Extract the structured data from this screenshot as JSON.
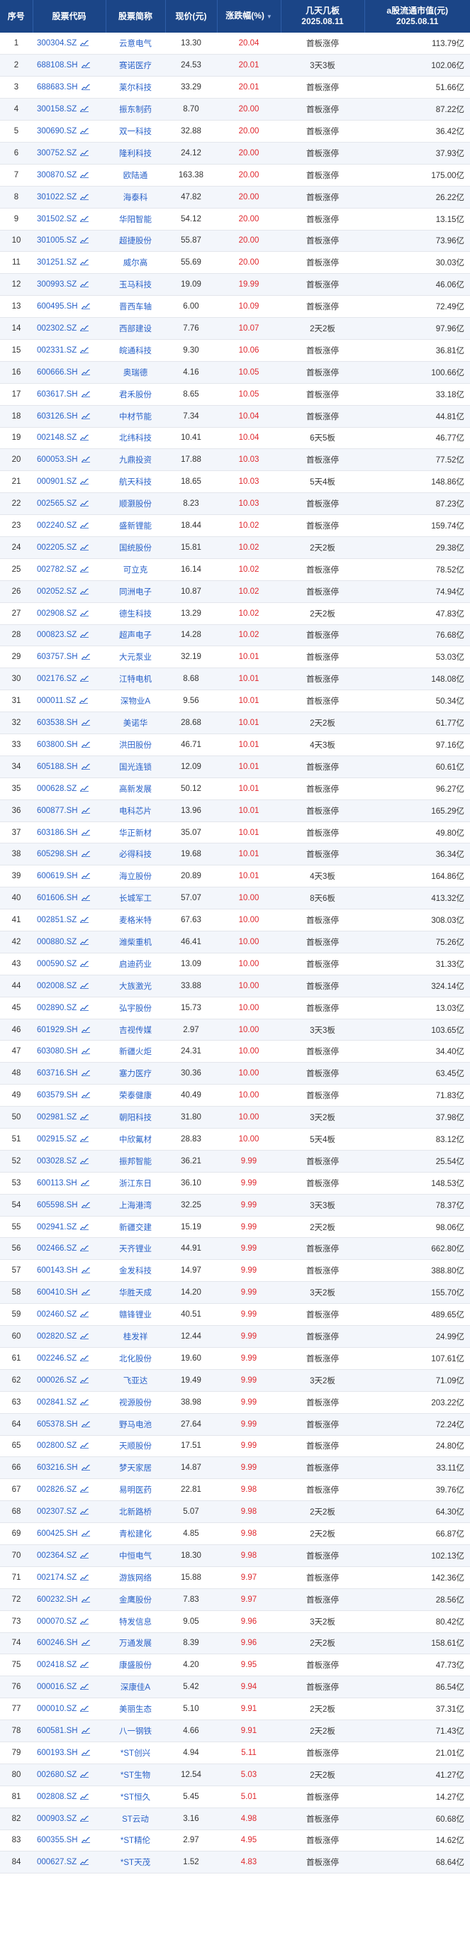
{
  "headers": {
    "index": "序号",
    "code": "股票代码",
    "name": "股票简称",
    "price": "现价(元)",
    "change": "涨跌幅(%)",
    "board_line1": "几天几板",
    "board_line2": "2025.08.11",
    "cap_line1": "a股流通市值(元)",
    "cap_line2": "2025.08.11"
  },
  "icons": {
    "sort": "sort-desc-icon",
    "chart": "trend-chart-icon"
  },
  "colors": {
    "header_bg": "#1b4587",
    "link": "#2a62c9",
    "up": "#e0282e"
  },
  "rows": [
    {
      "idx": "1",
      "code": "300304.SZ",
      "name": "云意电气",
      "price": "13.30",
      "change": "20.04",
      "board": "首板涨停",
      "cap": "113.79亿"
    },
    {
      "idx": "2",
      "code": "688108.SH",
      "name": "赛诺医疗",
      "price": "24.53",
      "change": "20.01",
      "board": "3天3板",
      "cap": "102.06亿"
    },
    {
      "idx": "3",
      "code": "688683.SH",
      "name": "莱尔科技",
      "price": "33.29",
      "change": "20.01",
      "board": "首板涨停",
      "cap": "51.66亿"
    },
    {
      "idx": "4",
      "code": "300158.SZ",
      "name": "振东制药",
      "price": "8.70",
      "change": "20.00",
      "board": "首板涨停",
      "cap": "87.22亿"
    },
    {
      "idx": "5",
      "code": "300690.SZ",
      "name": "双一科技",
      "price": "32.88",
      "change": "20.00",
      "board": "首板涨停",
      "cap": "36.42亿"
    },
    {
      "idx": "6",
      "code": "300752.SZ",
      "name": "隆利科技",
      "price": "24.12",
      "change": "20.00",
      "board": "首板涨停",
      "cap": "37.93亿"
    },
    {
      "idx": "7",
      "code": "300870.SZ",
      "name": "欧陆通",
      "price": "163.38",
      "change": "20.00",
      "board": "首板涨停",
      "cap": "175.00亿"
    },
    {
      "idx": "8",
      "code": "301022.SZ",
      "name": "海泰科",
      "price": "47.82",
      "change": "20.00",
      "board": "首板涨停",
      "cap": "26.22亿"
    },
    {
      "idx": "9",
      "code": "301502.SZ",
      "name": "华阳智能",
      "price": "54.12",
      "change": "20.00",
      "board": "首板涨停",
      "cap": "13.15亿"
    },
    {
      "idx": "10",
      "code": "301005.SZ",
      "name": "超捷股份",
      "price": "55.87",
      "change": "20.00",
      "board": "首板涨停",
      "cap": "73.96亿"
    },
    {
      "idx": "11",
      "code": "301251.SZ",
      "name": "威尔高",
      "price": "55.69",
      "change": "20.00",
      "board": "首板涨停",
      "cap": "30.03亿"
    },
    {
      "idx": "12",
      "code": "300993.SZ",
      "name": "玉马科技",
      "price": "19.09",
      "change": "19.99",
      "board": "首板涨停",
      "cap": "46.06亿"
    },
    {
      "idx": "13",
      "code": "600495.SH",
      "name": "晋西车轴",
      "price": "6.00",
      "change": "10.09",
      "board": "首板涨停",
      "cap": "72.49亿"
    },
    {
      "idx": "14",
      "code": "002302.SZ",
      "name": "西部建设",
      "price": "7.76",
      "change": "10.07",
      "board": "2天2板",
      "cap": "97.96亿"
    },
    {
      "idx": "15",
      "code": "002331.SZ",
      "name": "皖通科技",
      "price": "9.30",
      "change": "10.06",
      "board": "首板涨停",
      "cap": "36.81亿"
    },
    {
      "idx": "16",
      "code": "600666.SH",
      "name": "奥瑞德",
      "price": "4.16",
      "change": "10.05",
      "board": "首板涨停",
      "cap": "100.66亿"
    },
    {
      "idx": "17",
      "code": "603617.SH",
      "name": "君禾股份",
      "price": "8.65",
      "change": "10.05",
      "board": "首板涨停",
      "cap": "33.18亿"
    },
    {
      "idx": "18",
      "code": "603126.SH",
      "name": "中材节能",
      "price": "7.34",
      "change": "10.04",
      "board": "首板涨停",
      "cap": "44.81亿"
    },
    {
      "idx": "19",
      "code": "002148.SZ",
      "name": "北纬科技",
      "price": "10.41",
      "change": "10.04",
      "board": "6天5板",
      "cap": "46.77亿"
    },
    {
      "idx": "20",
      "code": "600053.SH",
      "name": "九鼎投资",
      "price": "17.88",
      "change": "10.03",
      "board": "首板涨停",
      "cap": "77.52亿"
    },
    {
      "idx": "21",
      "code": "000901.SZ",
      "name": "航天科技",
      "price": "18.65",
      "change": "10.03",
      "board": "5天4板",
      "cap": "148.86亿"
    },
    {
      "idx": "22",
      "code": "002565.SZ",
      "name": "顺灏股份",
      "price": "8.23",
      "change": "10.03",
      "board": "首板涨停",
      "cap": "87.23亿"
    },
    {
      "idx": "23",
      "code": "002240.SZ",
      "name": "盛新锂能",
      "price": "18.44",
      "change": "10.02",
      "board": "首板涨停",
      "cap": "159.74亿"
    },
    {
      "idx": "24",
      "code": "002205.SZ",
      "name": "国统股份",
      "price": "15.81",
      "change": "10.02",
      "board": "2天2板",
      "cap": "29.38亿"
    },
    {
      "idx": "25",
      "code": "002782.SZ",
      "name": "可立克",
      "price": "16.14",
      "change": "10.02",
      "board": "首板涨停",
      "cap": "78.52亿"
    },
    {
      "idx": "26",
      "code": "002052.SZ",
      "name": "同洲电子",
      "price": "10.87",
      "change": "10.02",
      "board": "首板涨停",
      "cap": "74.94亿"
    },
    {
      "idx": "27",
      "code": "002908.SZ",
      "name": "德生科技",
      "price": "13.29",
      "change": "10.02",
      "board": "2天2板",
      "cap": "47.83亿"
    },
    {
      "idx": "28",
      "code": "000823.SZ",
      "name": "超声电子",
      "price": "14.28",
      "change": "10.02",
      "board": "首板涨停",
      "cap": "76.68亿"
    },
    {
      "idx": "29",
      "code": "603757.SH",
      "name": "大元泵业",
      "price": "32.19",
      "change": "10.01",
      "board": "首板涨停",
      "cap": "53.03亿"
    },
    {
      "idx": "30",
      "code": "002176.SZ",
      "name": "江特电机",
      "price": "8.68",
      "change": "10.01",
      "board": "首板涨停",
      "cap": "148.08亿"
    },
    {
      "idx": "31",
      "code": "000011.SZ",
      "name": "深物业A",
      "price": "9.56",
      "change": "10.01",
      "board": "首板涨停",
      "cap": "50.34亿"
    },
    {
      "idx": "32",
      "code": "603538.SH",
      "name": "美诺华",
      "price": "28.68",
      "change": "10.01",
      "board": "2天2板",
      "cap": "61.77亿"
    },
    {
      "idx": "33",
      "code": "603800.SH",
      "name": "洪田股份",
      "price": "46.71",
      "change": "10.01",
      "board": "4天3板",
      "cap": "97.16亿"
    },
    {
      "idx": "34",
      "code": "605188.SH",
      "name": "国光连锁",
      "price": "12.09",
      "change": "10.01",
      "board": "首板涨停",
      "cap": "60.61亿"
    },
    {
      "idx": "35",
      "code": "000628.SZ",
      "name": "高新发展",
      "price": "50.12",
      "change": "10.01",
      "board": "首板涨停",
      "cap": "96.27亿"
    },
    {
      "idx": "36",
      "code": "600877.SH",
      "name": "电科芯片",
      "price": "13.96",
      "change": "10.01",
      "board": "首板涨停",
      "cap": "165.29亿"
    },
    {
      "idx": "37",
      "code": "603186.SH",
      "name": "华正新材",
      "price": "35.07",
      "change": "10.01",
      "board": "首板涨停",
      "cap": "49.80亿"
    },
    {
      "idx": "38",
      "code": "605298.SH",
      "name": "必得科技",
      "price": "19.68",
      "change": "10.01",
      "board": "首板涨停",
      "cap": "36.34亿"
    },
    {
      "idx": "39",
      "code": "600619.SH",
      "name": "海立股份",
      "price": "20.89",
      "change": "10.01",
      "board": "4天3板",
      "cap": "164.86亿"
    },
    {
      "idx": "40",
      "code": "601606.SH",
      "name": "长城军工",
      "price": "57.07",
      "change": "10.00",
      "board": "8天6板",
      "cap": "413.32亿"
    },
    {
      "idx": "41",
      "code": "002851.SZ",
      "name": "麦格米特",
      "price": "67.63",
      "change": "10.00",
      "board": "首板涨停",
      "cap": "308.03亿"
    },
    {
      "idx": "42",
      "code": "000880.SZ",
      "name": "潍柴重机",
      "price": "46.41",
      "change": "10.00",
      "board": "首板涨停",
      "cap": "75.26亿"
    },
    {
      "idx": "43",
      "code": "000590.SZ",
      "name": "启迪药业",
      "price": "13.09",
      "change": "10.00",
      "board": "首板涨停",
      "cap": "31.33亿"
    },
    {
      "idx": "44",
      "code": "002008.SZ",
      "name": "大族激光",
      "price": "33.88",
      "change": "10.00",
      "board": "首板涨停",
      "cap": "324.14亿"
    },
    {
      "idx": "45",
      "code": "002890.SZ",
      "name": "弘宇股份",
      "price": "15.73",
      "change": "10.00",
      "board": "首板涨停",
      "cap": "13.03亿"
    },
    {
      "idx": "46",
      "code": "601929.SH",
      "name": "吉视传媒",
      "price": "2.97",
      "change": "10.00",
      "board": "3天3板",
      "cap": "103.65亿"
    },
    {
      "idx": "47",
      "code": "603080.SH",
      "name": "新疆火炬",
      "price": "24.31",
      "change": "10.00",
      "board": "首板涨停",
      "cap": "34.40亿"
    },
    {
      "idx": "48",
      "code": "603716.SH",
      "name": "塞力医疗",
      "price": "30.36",
      "change": "10.00",
      "board": "首板涨停",
      "cap": "63.45亿"
    },
    {
      "idx": "49",
      "code": "603579.SH",
      "name": "荣泰健康",
      "price": "40.49",
      "change": "10.00",
      "board": "首板涨停",
      "cap": "71.83亿"
    },
    {
      "idx": "50",
      "code": "002981.SZ",
      "name": "朝阳科技",
      "price": "31.80",
      "change": "10.00",
      "board": "3天2板",
      "cap": "37.98亿"
    },
    {
      "idx": "51",
      "code": "002915.SZ",
      "name": "中欣氟材",
      "price": "28.83",
      "change": "10.00",
      "board": "5天4板",
      "cap": "83.12亿"
    },
    {
      "idx": "52",
      "code": "003028.SZ",
      "name": "振邦智能",
      "price": "36.21",
      "change": "9.99",
      "board": "首板涨停",
      "cap": "25.54亿"
    },
    {
      "idx": "53",
      "code": "600113.SH",
      "name": "浙江东日",
      "price": "36.10",
      "change": "9.99",
      "board": "首板涨停",
      "cap": "148.53亿"
    },
    {
      "idx": "54",
      "code": "605598.SH",
      "name": "上海港湾",
      "price": "32.25",
      "change": "9.99",
      "board": "3天3板",
      "cap": "78.37亿"
    },
    {
      "idx": "55",
      "code": "002941.SZ",
      "name": "新疆交建",
      "price": "15.19",
      "change": "9.99",
      "board": "2天2板",
      "cap": "98.06亿"
    },
    {
      "idx": "56",
      "code": "002466.SZ",
      "name": "天齐锂业",
      "price": "44.91",
      "change": "9.99",
      "board": "首板涨停",
      "cap": "662.80亿"
    },
    {
      "idx": "57",
      "code": "600143.SH",
      "name": "金发科技",
      "price": "14.97",
      "change": "9.99",
      "board": "首板涨停",
      "cap": "388.80亿"
    },
    {
      "idx": "58",
      "code": "600410.SH",
      "name": "华胜天成",
      "price": "14.20",
      "change": "9.99",
      "board": "3天2板",
      "cap": "155.70亿"
    },
    {
      "idx": "59",
      "code": "002460.SZ",
      "name": "赣锋锂业",
      "price": "40.51",
      "change": "9.99",
      "board": "首板涨停",
      "cap": "489.65亿"
    },
    {
      "idx": "60",
      "code": "002820.SZ",
      "name": "桂发祥",
      "price": "12.44",
      "change": "9.99",
      "board": "首板涨停",
      "cap": "24.99亿"
    },
    {
      "idx": "61",
      "code": "002246.SZ",
      "name": "北化股份",
      "price": "19.60",
      "change": "9.99",
      "board": "首板涨停",
      "cap": "107.61亿"
    },
    {
      "idx": "62",
      "code": "000026.SZ",
      "name": "飞亚达",
      "price": "19.49",
      "change": "9.99",
      "board": "3天2板",
      "cap": "71.09亿"
    },
    {
      "idx": "63",
      "code": "002841.SZ",
      "name": "视源股份",
      "price": "38.98",
      "change": "9.99",
      "board": "首板涨停",
      "cap": "203.22亿"
    },
    {
      "idx": "64",
      "code": "605378.SH",
      "name": "野马电池",
      "price": "27.64",
      "change": "9.99",
      "board": "首板涨停",
      "cap": "72.24亿"
    },
    {
      "idx": "65",
      "code": "002800.SZ",
      "name": "天顺股份",
      "price": "17.51",
      "change": "9.99",
      "board": "首板涨停",
      "cap": "24.80亿"
    },
    {
      "idx": "66",
      "code": "603216.SH",
      "name": "梦天家居",
      "price": "14.87",
      "change": "9.99",
      "board": "首板涨停",
      "cap": "33.11亿"
    },
    {
      "idx": "67",
      "code": "002826.SZ",
      "name": "易明医药",
      "price": "22.81",
      "change": "9.98",
      "board": "首板涨停",
      "cap": "39.76亿"
    },
    {
      "idx": "68",
      "code": "002307.SZ",
      "name": "北新路桥",
      "price": "5.07",
      "change": "9.98",
      "board": "2天2板",
      "cap": "64.30亿"
    },
    {
      "idx": "69",
      "code": "600425.SH",
      "name": "青松建化",
      "price": "4.85",
      "change": "9.98",
      "board": "2天2板",
      "cap": "66.87亿"
    },
    {
      "idx": "70",
      "code": "002364.SZ",
      "name": "中恒电气",
      "price": "18.30",
      "change": "9.98",
      "board": "首板涨停",
      "cap": "102.13亿"
    },
    {
      "idx": "71",
      "code": "002174.SZ",
      "name": "游族网络",
      "price": "15.88",
      "change": "9.97",
      "board": "首板涨停",
      "cap": "142.36亿"
    },
    {
      "idx": "72",
      "code": "600232.SH",
      "name": "金鹰股份",
      "price": "7.83",
      "change": "9.97",
      "board": "首板涨停",
      "cap": "28.56亿"
    },
    {
      "idx": "73",
      "code": "000070.SZ",
      "name": "特发信息",
      "price": "9.05",
      "change": "9.96",
      "board": "3天2板",
      "cap": "80.42亿"
    },
    {
      "idx": "74",
      "code": "600246.SH",
      "name": "万通发展",
      "price": "8.39",
      "change": "9.96",
      "board": "2天2板",
      "cap": "158.61亿"
    },
    {
      "idx": "75",
      "code": "002418.SZ",
      "name": "康盛股份",
      "price": "4.20",
      "change": "9.95",
      "board": "首板涨停",
      "cap": "47.73亿"
    },
    {
      "idx": "76",
      "code": "000016.SZ",
      "name": "深康佳A",
      "price": "5.42",
      "change": "9.94",
      "board": "首板涨停",
      "cap": "86.54亿"
    },
    {
      "idx": "77",
      "code": "000010.SZ",
      "name": "美丽生态",
      "price": "5.10",
      "change": "9.91",
      "board": "2天2板",
      "cap": "37.31亿"
    },
    {
      "idx": "78",
      "code": "600581.SH",
      "name": "八一钢铁",
      "price": "4.66",
      "change": "9.91",
      "board": "2天2板",
      "cap": "71.43亿"
    },
    {
      "idx": "79",
      "code": "600193.SH",
      "name": "*ST创兴",
      "price": "4.94",
      "change": "5.11",
      "board": "首板涨停",
      "cap": "21.01亿"
    },
    {
      "idx": "80",
      "code": "002680.SZ",
      "name": "*ST生物",
      "price": "12.54",
      "change": "5.03",
      "board": "2天2板",
      "cap": "41.27亿"
    },
    {
      "idx": "81",
      "code": "002808.SZ",
      "name": "*ST恒久",
      "price": "5.45",
      "change": "5.01",
      "board": "首板涨停",
      "cap": "14.27亿"
    },
    {
      "idx": "82",
      "code": "000903.SZ",
      "name": "ST云动",
      "price": "3.16",
      "change": "4.98",
      "board": "首板涨停",
      "cap": "60.68亿"
    },
    {
      "idx": "83",
      "code": "600355.SH",
      "name": "*ST精伦",
      "price": "2.97",
      "change": "4.95",
      "board": "首板涨停",
      "cap": "14.62亿"
    },
    {
      "idx": "84",
      "code": "000627.SZ",
      "name": "*ST天茂",
      "price": "1.52",
      "change": "4.83",
      "board": "首板涨停",
      "cap": "68.64亿"
    }
  ]
}
